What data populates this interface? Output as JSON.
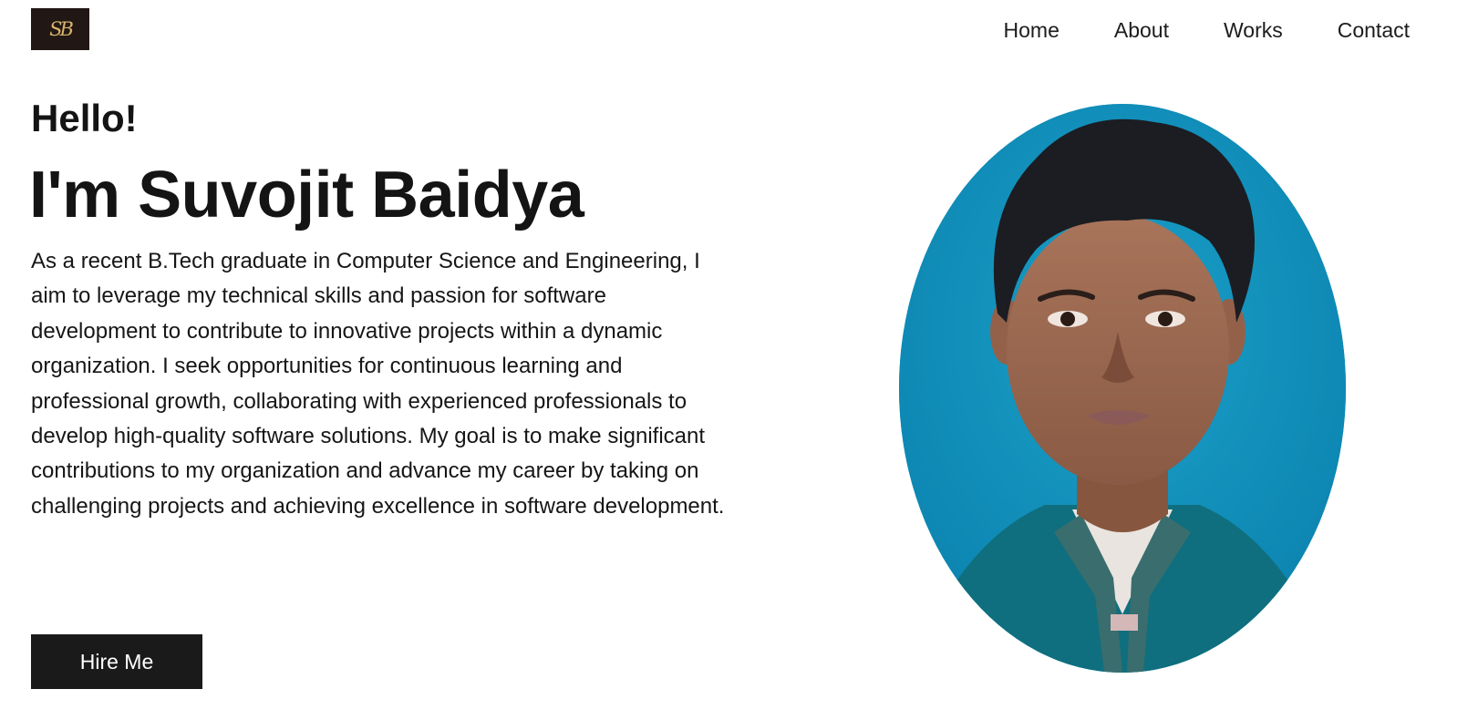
{
  "header": {
    "logo_text": "SB",
    "nav": [
      {
        "label": "Home"
      },
      {
        "label": "About"
      },
      {
        "label": "Works"
      },
      {
        "label": "Contact"
      }
    ]
  },
  "hero": {
    "greeting": "Hello!",
    "name": "I'm Suvojit Baidya",
    "bio": "As a recent B.Tech graduate in Computer Science and Engineering, I aim to leverage my technical skills and passion for software development to contribute to innovative projects within a dynamic organization. I seek opportunities for continuous learning and professional growth, collaborating with experienced professionals to develop high-quality software solutions. My goal is to make significant contributions to my organization and advance my career by taking on challenging projects and achieving excellence in software development.",
    "cta_label": "Hire Me"
  },
  "colors": {
    "accent": "#1a1a1a",
    "logo_bg": "#211714",
    "logo_fg": "#d8b56a",
    "portrait_bg": "#0a88b4"
  }
}
